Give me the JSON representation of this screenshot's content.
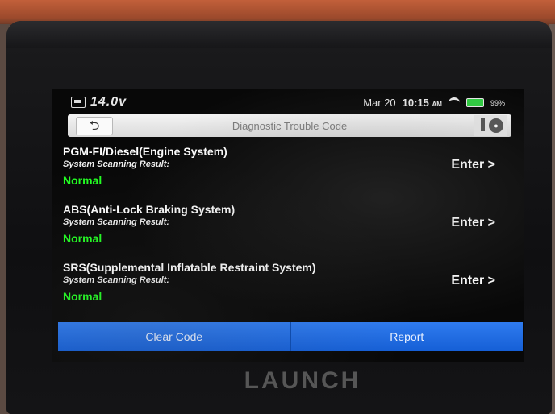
{
  "status_bar": {
    "voltage": "14.0v",
    "date": "Mar 20",
    "time": "10:15",
    "ampm": "AM",
    "battery": "99%",
    "icons": [
      "car-icon",
      "wifi-icon",
      "battery-icon"
    ]
  },
  "titlebar": {
    "title": "Diagnostic Trouble Code",
    "back_icon": "back-arrow-icon",
    "camera_icon": "camera-icon"
  },
  "systems": [
    {
      "name": "PGM-FI/Diesel(Engine System)",
      "label": "System Scanning Result:",
      "status": "Normal",
      "action": "Enter >"
    },
    {
      "name": "ABS(Anti-Lock Braking System)",
      "label": "System Scanning Result:",
      "status": "Normal",
      "action": "Enter >"
    },
    {
      "name": "SRS(Supplemental Inflatable Restraint System)",
      "label": "System Scanning Result:",
      "status": "Normal",
      "action": "Enter >"
    }
  ],
  "buttons": {
    "clear": "Clear Code",
    "report": "Report"
  },
  "brand": "LAUNCH",
  "colors": {
    "status_ok": "#22ff22",
    "accent": "#1f6fe6"
  }
}
